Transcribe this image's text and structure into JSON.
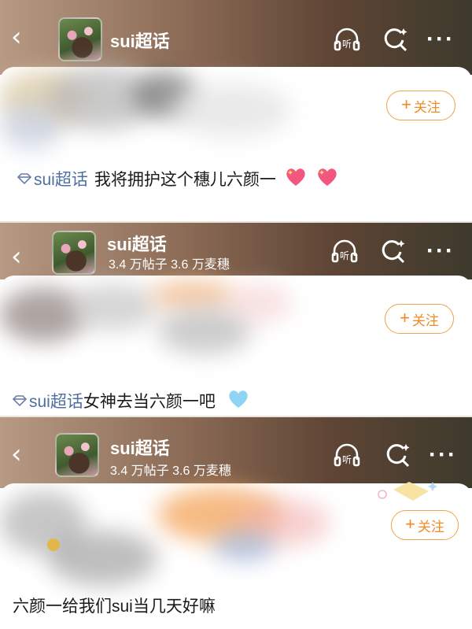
{
  "panels": [
    {
      "header": {
        "title": "sui超话",
        "stats": ""
      },
      "follow_label": "关注",
      "topic_label": "sui超话",
      "post_text": "我将拥护这个穗儿六颜一",
      "emojis": [
        "pink-heart-sparkle",
        "pink-heart-sparkle"
      ]
    },
    {
      "header": {
        "title": "sui超话",
        "stats": "3.4 万帖子  3.6 万麦穗"
      },
      "follow_label": "关注",
      "topic_label": "sui超话",
      "post_text": "女神去当六颜一吧",
      "emojis": [
        "light-blue-heart"
      ]
    },
    {
      "header": {
        "title": "sui超话",
        "stats": "3.4 万帖子  3.6 万麦穗"
      },
      "follow_label": "关注",
      "topic_label": "",
      "post_text": "六颜一给我们sui当几天好嘛",
      "emojis": []
    }
  ],
  "icons": {
    "back": "back-chevron-icon",
    "listen": "headphones-listen-icon",
    "search": "search-sparkle-icon",
    "more": "more-dots-icon"
  },
  "colors": {
    "follow_accent": "#f08a24",
    "topic_link": "#4e6fa0"
  }
}
